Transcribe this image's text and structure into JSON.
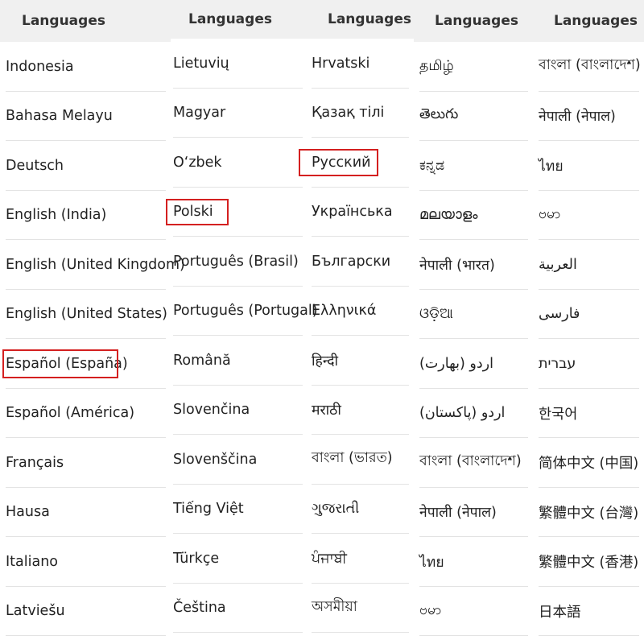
{
  "columns": [
    {
      "header": "Languages",
      "items": [
        "Indonesia",
        "Bahasa Melayu",
        "Deutsch",
        "English (India)",
        "English (United Kingdom)",
        "English (United States)",
        "Español (España)",
        "Español (América)",
        "Français",
        "Hausa",
        "Italiano",
        "Latviešu"
      ],
      "highlighted": [
        6
      ]
    },
    {
      "header": "Languages",
      "items": [
        "Lietuvių",
        "Magyar",
        "O‘zbek",
        "Polski",
        "Português (Brasil)",
        "Português (Portugal)",
        "Română",
        "Slovenčina",
        "Slovenščina",
        "Tiếng Việt",
        "Türkçe",
        "Čeština"
      ],
      "highlighted": [
        3
      ]
    },
    {
      "header": "Languages",
      "items": [
        "Hrvatski",
        "Қазақ тілі",
        "Русский",
        "Українська",
        "Български",
        "Ελληνικά",
        "हिन्दी",
        "मराठी",
        "বাংলা (ভারত)",
        "ગુજરાતી",
        "ਪੰਜਾਬੀ",
        "অসমীয়া"
      ],
      "highlighted": [
        2
      ]
    },
    {
      "header": "Languages",
      "items": [
        "தமிழ்",
        "తెలుగు",
        "ಕನ್ನಡ",
        "മലയാളം",
        "नेपाली (भारत)",
        "ଓଡ଼ିଆ",
        "اردو (بھارت)",
        "اردو (پاکستان)",
        "বাংলা (বাংলাদেশ)",
        "नेपाली (नेपाल)",
        "ไทย",
        "ဗမာ"
      ],
      "highlighted": []
    },
    {
      "header": "Languages",
      "items": [
        "বাংলা (বাংলাদেশ)",
        "नेपाली (नेपाल)",
        "ไทย",
        "ဗမာ",
        "العربية",
        "فارسی",
        "עברית",
        "한국어",
        "简体中文 (中国)",
        "繁體中文 (台灣)",
        "繁體中文 (香港)",
        "日本語"
      ],
      "highlighted": []
    }
  ],
  "colors": {
    "highlight": "#d42020",
    "header_bg": "#f0f0f0",
    "divider": "#e3e3e3"
  }
}
